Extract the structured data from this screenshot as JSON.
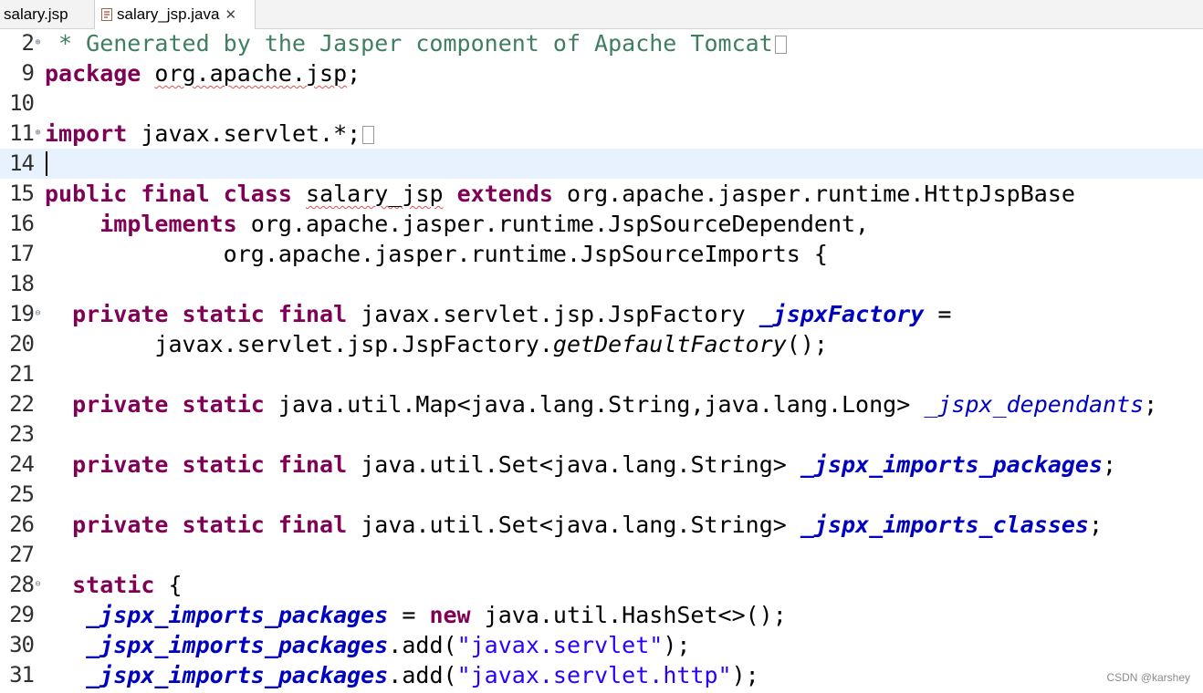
{
  "tabs": [
    {
      "label": "salary.jsp",
      "active": false
    },
    {
      "label": "salary_jsp.java",
      "active": true
    }
  ],
  "editor": {
    "current_line": "14",
    "lines": [
      {
        "num": "2",
        "fold": "plus"
      },
      {
        "num": "9"
      },
      {
        "num": "10"
      },
      {
        "num": "11",
        "fold": "plus"
      },
      {
        "num": "14"
      },
      {
        "num": "15"
      },
      {
        "num": "16"
      },
      {
        "num": "17"
      },
      {
        "num": "18"
      },
      {
        "num": "19",
        "fold": "minus"
      },
      {
        "num": "20"
      },
      {
        "num": "21"
      },
      {
        "num": "22"
      },
      {
        "num": "23"
      },
      {
        "num": "24"
      },
      {
        "num": "25"
      },
      {
        "num": "26"
      },
      {
        "num": "27"
      },
      {
        "num": "28",
        "fold": "minus"
      },
      {
        "num": "29"
      },
      {
        "num": "30"
      },
      {
        "num": "31"
      }
    ],
    "code": {
      "l2_comment": " * Generated by the Jasper component of Apache Tomcat",
      "kw_package": "package",
      "pkg_name": "org.apache.jsp",
      "semicolon": ";",
      "kw_import": "import",
      "import_name": "javax.servlet.*;",
      "kw_public": "public",
      "kw_final": "final",
      "kw_class": "class",
      "class_name": "salary_jsp",
      "kw_extends": "extends",
      "extends_type": "org.apache.jasper.runtime.HttpJspBase",
      "kw_implements": "implements",
      "impl1": "org.apache.jasper.runtime.JspSourceDependent,",
      "impl2": "org.apache.jasper.runtime.JspSourceImports {",
      "kw_private": "private",
      "kw_static": "static",
      "jsp_factory_type": "javax.servlet.jsp.JspFactory",
      "f_jspxFactory": "_jspxFactory",
      "assign": " =",
      "factory_call_prefix": "javax.servlet.jsp.JspFactory.",
      "factory_method": "getDefaultFactory",
      "factory_call_suffix": "();",
      "map_type": "java.util.Map<java.lang.String,java.lang.Long>",
      "f_dependants": "_jspx_dependants",
      "set_type": "java.util.Set<java.lang.String>",
      "f_imports_packages": "_jspx_imports_packages",
      "f_imports_classes": "_jspx_imports_classes",
      "static_brace": " {",
      "assign_new": " = ",
      "kw_new": "new",
      "hashset": " java.util.HashSet<>();",
      "add_open": ".add(",
      "str_servlet": "\"javax.servlet\"",
      "str_servlet_http": "\"javax.servlet.http\"",
      "add_close": ");"
    }
  },
  "watermark": "CSDN @karshey"
}
